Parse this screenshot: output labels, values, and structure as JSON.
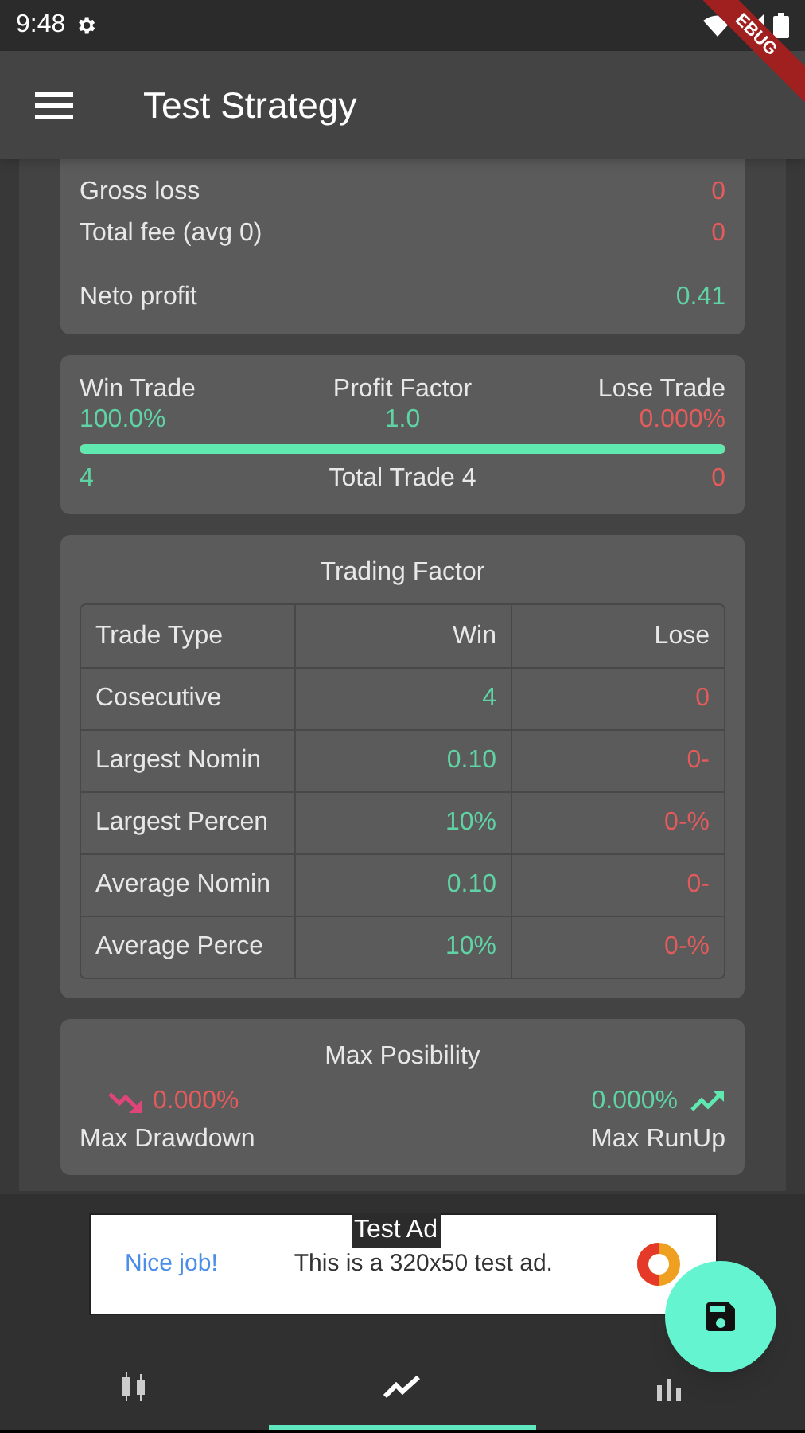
{
  "status_bar": {
    "time": "9:48"
  },
  "debug_banner": {
    "label": "EBUG"
  },
  "app_bar": {
    "title": "Test Strategy"
  },
  "summary": [
    {
      "label": "Gross loss",
      "value": "0",
      "color": "#e35b5b",
      "kind": "line"
    },
    {
      "label": "Total fee (avg 0)",
      "value": "0",
      "color": "#e35b5b",
      "kind": "line"
    },
    {
      "label": "Neto profit",
      "value": "0.41",
      "color": "#5fd3a4",
      "kind": "total"
    }
  ],
  "trades": {
    "win_label": "Win Trade",
    "win_pct": "100.0%",
    "factor_label": "Profit Factor",
    "factor": "1.0",
    "lose_label": "Lose Trade",
    "lose_pct": "0.000%",
    "level": 1.0,
    "win_count": "4",
    "total": "Total Trade 4",
    "lose_count": "0"
  },
  "trading_factor": {
    "title": "Trading Factor",
    "columns": [
      "Trade Type",
      "Win",
      "Lose"
    ],
    "rows": [
      [
        "Cosecutive",
        "4",
        "0"
      ],
      [
        "Largest Nomin",
        "0.10",
        "0-"
      ],
      [
        "Largest Percen",
        "10%",
        "0-%"
      ],
      [
        "Average Nomin",
        "0.10",
        "0-"
      ],
      [
        "Average Perce",
        "10%",
        "0-%"
      ]
    ]
  },
  "max_posibility": {
    "title": "Max Posibility",
    "drawdown_value": "0.000%",
    "drawdown_label": "Max Drawdown",
    "runup_value": "0.000%",
    "runup_label": "Max RunUp"
  },
  "ad": {
    "badge": "Test Ad",
    "headline": "Nice job!",
    "body": "This is a 320x50 test ad."
  },
  "bottom_nav": [
    {
      "kind": "candles",
      "selected": false
    },
    {
      "kind": "line",
      "selected": true
    },
    {
      "kind": "bars",
      "selected": false
    }
  ]
}
